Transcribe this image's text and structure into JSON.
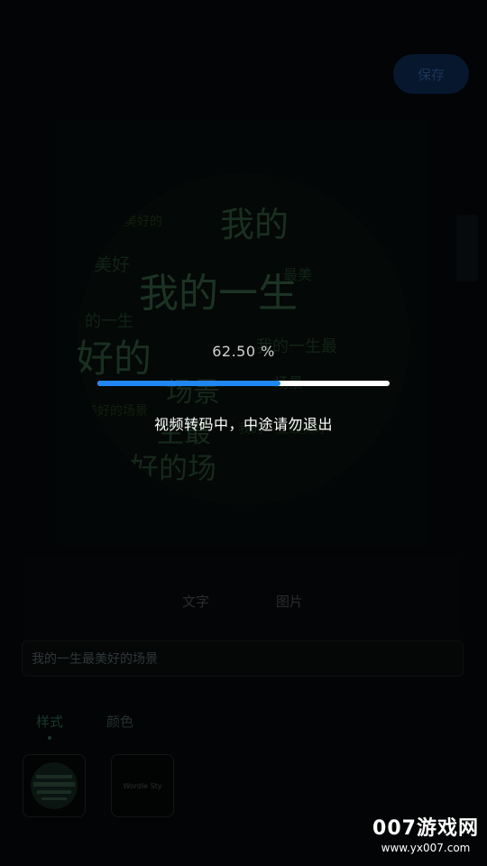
{
  "toolbar": {
    "save_label": "保存"
  },
  "wordcloud": {
    "words": [
      "我的一生",
      "最美好的",
      "场景",
      "我的一生最",
      "好的",
      "场景",
      "最美好",
      "的一生",
      "我的",
      "最美",
      "生最",
      "好的场",
      "美好的场景",
      "我的一生最美好"
    ]
  },
  "progress": {
    "percent_text": "62.50 %",
    "value": 0.625,
    "message": "视频转码中，中途请勿退出"
  },
  "editor": {
    "tabs": [
      {
        "label": "文字"
      },
      {
        "label": "图片"
      }
    ],
    "text_value": "我的一生最美好的场景",
    "sub_tabs": [
      {
        "label": "样式"
      },
      {
        "label": "颜色"
      }
    ],
    "thumbs": [
      {
        "label": ""
      },
      {
        "label": "Wordle Sty"
      }
    ]
  },
  "watermark": {
    "title": "007游戏网",
    "url": "www.yx007.com"
  },
  "colors": {
    "accent": "#1f86f2",
    "progress_track": "#ffffff",
    "background": "#020405"
  }
}
